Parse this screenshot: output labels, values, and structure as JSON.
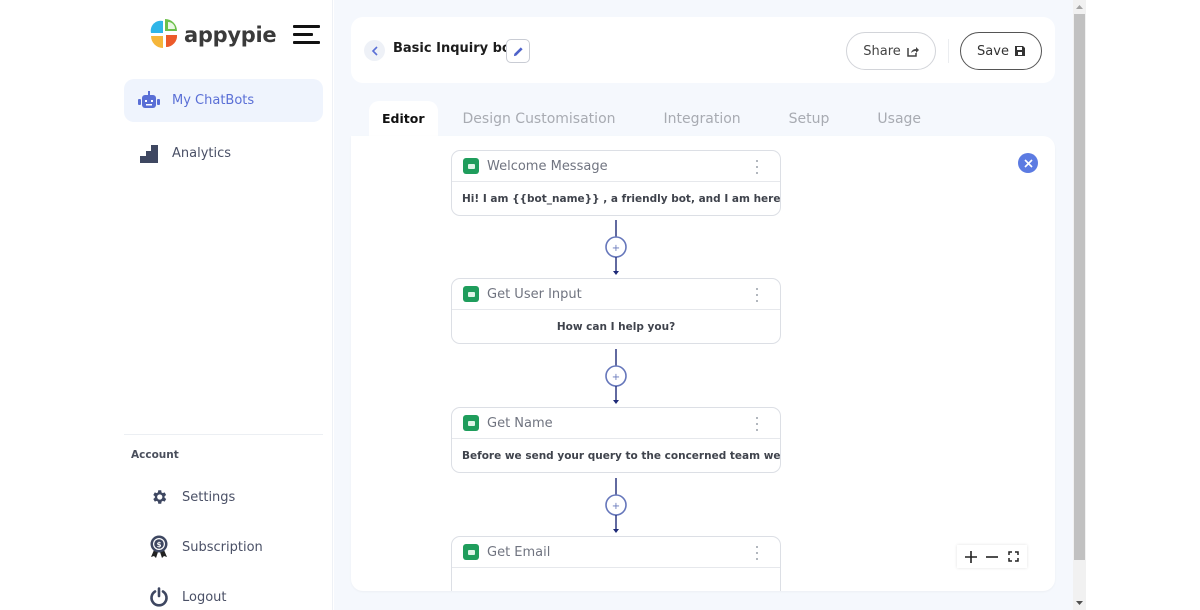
{
  "brand": {
    "name": "appypie",
    "colors": {
      "accent": "#5c7be2",
      "node_icon": "#1f9d5c"
    }
  },
  "sidebar": {
    "nav": [
      {
        "label": "My ChatBots",
        "icon": "robot-icon",
        "active": true
      },
      {
        "label": "Analytics",
        "icon": "bar-chart-icon",
        "active": false
      }
    ],
    "account_label": "Account",
    "account_items": [
      {
        "label": "Settings",
        "icon": "gear-icon"
      },
      {
        "label": "Subscription",
        "icon": "badge-icon"
      },
      {
        "label": "Logout",
        "icon": "power-icon"
      }
    ]
  },
  "header": {
    "bot_name": "Basic Inquiry bot",
    "share_label": "Share",
    "save_label": "Save"
  },
  "tabs": [
    {
      "label": "Editor",
      "active": true
    },
    {
      "label": "Design Customisation",
      "active": false
    },
    {
      "label": "Integration",
      "active": false
    },
    {
      "label": "Setup",
      "active": false
    },
    {
      "label": "Usage",
      "active": false
    }
  ],
  "flow": {
    "nodes": [
      {
        "title": "Welcome Message",
        "body": "Hi! I am {{bot_name}} , a friendly bot, and I am here to a..."
      },
      {
        "title": "Get User Input",
        "body": "How can I help you?"
      },
      {
        "title": "Get Name",
        "body": "Before we send your query to the concerned team we'd a..."
      },
      {
        "title": "Get Email",
        "body": ""
      }
    ],
    "connector_label": "+"
  },
  "zoom_controls": {
    "zoom_in": "+",
    "zoom_out": "−"
  }
}
